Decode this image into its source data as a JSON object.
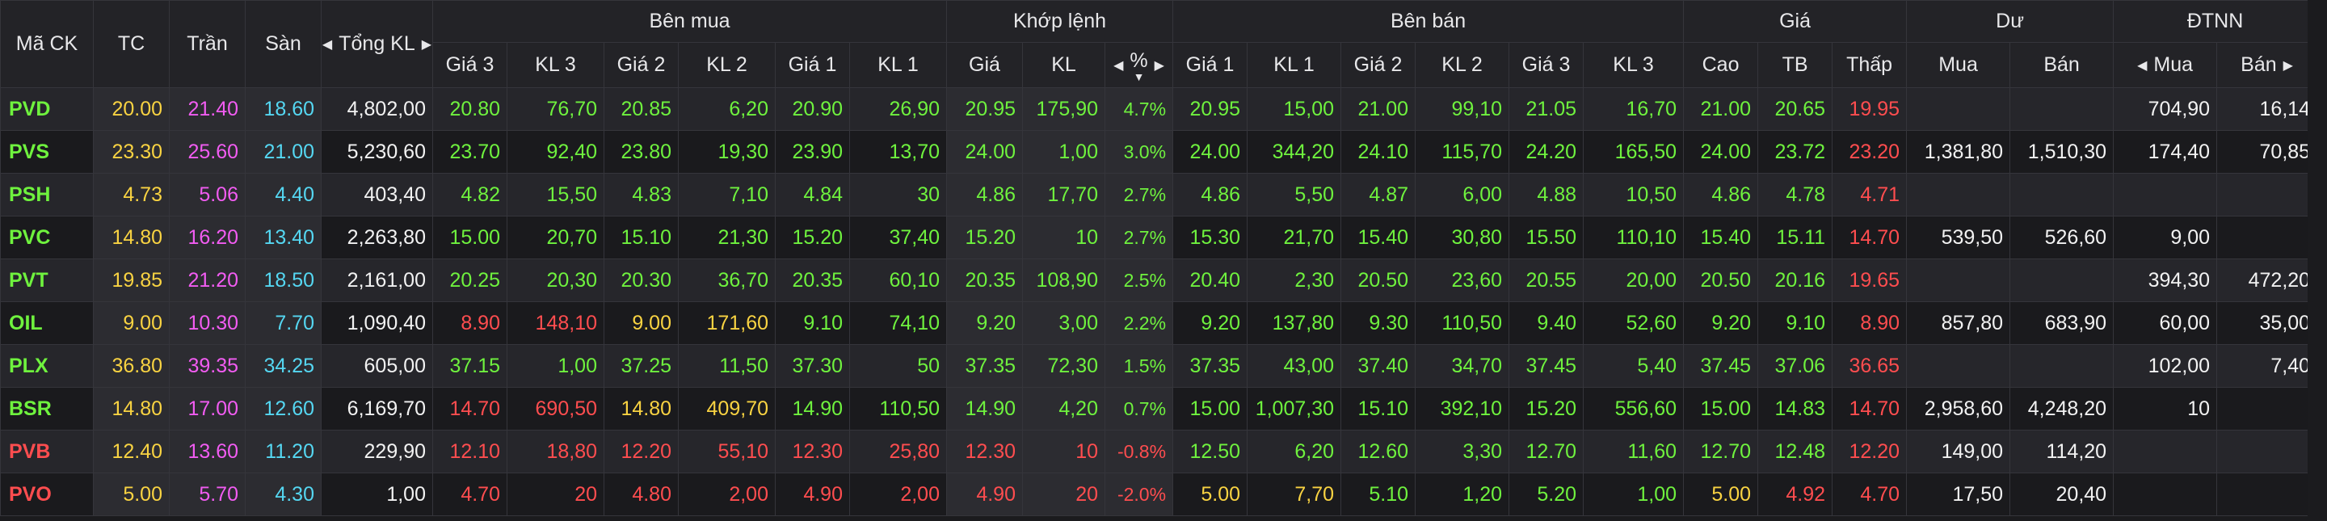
{
  "header": {
    "top": {
      "symbol": "Mã CK",
      "ref": "TC",
      "ceil": "Trần",
      "floor": "Sàn",
      "total_vol": "Tổng KL",
      "buy": "Bên mua",
      "match": "Khớp lệnh",
      "sell": "Bên bán",
      "price": "Giá",
      "surplus": "Dư",
      "foreign": "ĐTNN"
    },
    "sub": {
      "buy": [
        "Giá 3",
        "KL 3",
        "Giá 2",
        "KL 2",
        "Giá 1",
        "KL 1"
      ],
      "match": [
        "Giá",
        "KL",
        "%"
      ],
      "sell": [
        "Giá 1",
        "KL 1",
        "Giá 2",
        "KL 2",
        "Giá 3",
        "KL 3"
      ],
      "price": [
        "Cao",
        "TB",
        "Thấp"
      ],
      "surplus": [
        "Mua",
        "Bán"
      ],
      "foreign": [
        "Mua",
        "Bán"
      ]
    }
  },
  "rows": [
    {
      "symbol": "PVD",
      "c": "up",
      "ref": "20.00",
      "ceil": "21.40",
      "floor": "18.60",
      "total": "4,802,00",
      "buy": [
        [
          "20.80",
          "up"
        ],
        [
          "76,70",
          "up"
        ],
        [
          "20.85",
          "up"
        ],
        [
          "6,20",
          "up"
        ],
        [
          "20.90",
          "up"
        ],
        [
          "26,90",
          "up"
        ]
      ],
      "match": [
        [
          "20.95",
          "up"
        ],
        [
          "175,90",
          "up"
        ],
        [
          "4.7%",
          "up"
        ]
      ],
      "sell": [
        [
          "20.95",
          "up"
        ],
        [
          "15,00",
          "up"
        ],
        [
          "21.00",
          "up"
        ],
        [
          "99,10",
          "up"
        ],
        [
          "21.05",
          "up"
        ],
        [
          "16,70",
          "up"
        ]
      ],
      "high": [
        "21.00",
        "up"
      ],
      "avg": [
        "20.65",
        "up"
      ],
      "low": [
        "19.95",
        "down"
      ],
      "sur_buy": "",
      "sur_sell": "",
      "f_buy": "704,90",
      "f_sell": "16,14"
    },
    {
      "symbol": "PVS",
      "c": "up",
      "ref": "23.30",
      "ceil": "25.60",
      "floor": "21.00",
      "total": "5,230,60",
      "buy": [
        [
          "23.70",
          "up"
        ],
        [
          "92,40",
          "up"
        ],
        [
          "23.80",
          "up"
        ],
        [
          "19,30",
          "up"
        ],
        [
          "23.90",
          "up"
        ],
        [
          "13,70",
          "up"
        ]
      ],
      "match": [
        [
          "24.00",
          "up"
        ],
        [
          "1,00",
          "up"
        ],
        [
          "3.0%",
          "up"
        ]
      ],
      "sell": [
        [
          "24.00",
          "up"
        ],
        [
          "344,20",
          "up"
        ],
        [
          "24.10",
          "up"
        ],
        [
          "115,70",
          "up"
        ],
        [
          "24.20",
          "up"
        ],
        [
          "165,50",
          "up"
        ]
      ],
      "high": [
        "24.00",
        "up"
      ],
      "avg": [
        "23.72",
        "up"
      ],
      "low": [
        "23.20",
        "down"
      ],
      "sur_buy": "1,381,80",
      "sur_sell": "1,510,30",
      "f_buy": "174,40",
      "f_sell": "70,85"
    },
    {
      "symbol": "PSH",
      "c": "up",
      "ref": "4.73",
      "ceil": "5.06",
      "floor": "4.40",
      "total": "403,40",
      "buy": [
        [
          "4.82",
          "up"
        ],
        [
          "15,50",
          "up"
        ],
        [
          "4.83",
          "up"
        ],
        [
          "7,10",
          "up"
        ],
        [
          "4.84",
          "up"
        ],
        [
          "30",
          "up"
        ]
      ],
      "match": [
        [
          "4.86",
          "up"
        ],
        [
          "17,70",
          "up"
        ],
        [
          "2.7%",
          "up"
        ]
      ],
      "sell": [
        [
          "4.86",
          "up"
        ],
        [
          "5,50",
          "up"
        ],
        [
          "4.87",
          "up"
        ],
        [
          "6,00",
          "up"
        ],
        [
          "4.88",
          "up"
        ],
        [
          "10,50",
          "up"
        ]
      ],
      "high": [
        "4.86",
        "up"
      ],
      "avg": [
        "4.78",
        "up"
      ],
      "low": [
        "4.71",
        "down"
      ],
      "sur_buy": "",
      "sur_sell": "",
      "f_buy": "",
      "f_sell": ""
    },
    {
      "symbol": "PVC",
      "c": "up",
      "ref": "14.80",
      "ceil": "16.20",
      "floor": "13.40",
      "total": "2,263,80",
      "buy": [
        [
          "15.00",
          "up"
        ],
        [
          "20,70",
          "up"
        ],
        [
          "15.10",
          "up"
        ],
        [
          "21,30",
          "up"
        ],
        [
          "15.20",
          "up"
        ],
        [
          "37,40",
          "up"
        ]
      ],
      "match": [
        [
          "15.20",
          "up"
        ],
        [
          "10",
          "up"
        ],
        [
          "2.7%",
          "up"
        ]
      ],
      "sell": [
        [
          "15.30",
          "up"
        ],
        [
          "21,70",
          "up"
        ],
        [
          "15.40",
          "up"
        ],
        [
          "30,80",
          "up"
        ],
        [
          "15.50",
          "up"
        ],
        [
          "110,10",
          "up"
        ]
      ],
      "high": [
        "15.40",
        "up"
      ],
      "avg": [
        "15.11",
        "up"
      ],
      "low": [
        "14.70",
        "down"
      ],
      "sur_buy": "539,50",
      "sur_sell": "526,60",
      "f_buy": "9,00",
      "f_sell": ""
    },
    {
      "symbol": "PVT",
      "c": "up",
      "ref": "19.85",
      "ceil": "21.20",
      "floor": "18.50",
      "total": "2,161,00",
      "buy": [
        [
          "20.25",
          "up"
        ],
        [
          "20,30",
          "up"
        ],
        [
          "20.30",
          "up"
        ],
        [
          "36,70",
          "up"
        ],
        [
          "20.35",
          "up"
        ],
        [
          "60,10",
          "up"
        ]
      ],
      "match": [
        [
          "20.35",
          "up"
        ],
        [
          "108,90",
          "up"
        ],
        [
          "2.5%",
          "up"
        ]
      ],
      "sell": [
        [
          "20.40",
          "up"
        ],
        [
          "2,30",
          "up"
        ],
        [
          "20.50",
          "up"
        ],
        [
          "23,60",
          "up"
        ],
        [
          "20.55",
          "up"
        ],
        [
          "20,00",
          "up"
        ]
      ],
      "high": [
        "20.50",
        "up"
      ],
      "avg": [
        "20.16",
        "up"
      ],
      "low": [
        "19.65",
        "down"
      ],
      "sur_buy": "",
      "sur_sell": "",
      "f_buy": "394,30",
      "f_sell": "472,20"
    },
    {
      "symbol": "OIL",
      "c": "up",
      "ref": "9.00",
      "ceil": "10.30",
      "floor": "7.70",
      "total": "1,090,40",
      "buy": [
        [
          "8.90",
          "down"
        ],
        [
          "148,10",
          "down"
        ],
        [
          "9.00",
          "ref"
        ],
        [
          "171,60",
          "ref"
        ],
        [
          "9.10",
          "up"
        ],
        [
          "74,10",
          "up"
        ]
      ],
      "match": [
        [
          "9.20",
          "up"
        ],
        [
          "3,00",
          "up"
        ],
        [
          "2.2%",
          "up"
        ]
      ],
      "sell": [
        [
          "9.20",
          "up"
        ],
        [
          "137,80",
          "up"
        ],
        [
          "9.30",
          "up"
        ],
        [
          "110,50",
          "up"
        ],
        [
          "9.40",
          "up"
        ],
        [
          "52,60",
          "up"
        ]
      ],
      "high": [
        "9.20",
        "up"
      ],
      "avg": [
        "9.10",
        "up"
      ],
      "low": [
        "8.90",
        "down"
      ],
      "sur_buy": "857,80",
      "sur_sell": "683,90",
      "f_buy": "60,00",
      "f_sell": "35,00"
    },
    {
      "symbol": "PLX",
      "c": "up",
      "ref": "36.80",
      "ceil": "39.35",
      "floor": "34.25",
      "total": "605,00",
      "buy": [
        [
          "37.15",
          "up"
        ],
        [
          "1,00",
          "up"
        ],
        [
          "37.25",
          "up"
        ],
        [
          "11,50",
          "up"
        ],
        [
          "37.30",
          "up"
        ],
        [
          "50",
          "up"
        ]
      ],
      "match": [
        [
          "37.35",
          "up"
        ],
        [
          "72,30",
          "up"
        ],
        [
          "1.5%",
          "up"
        ]
      ],
      "sell": [
        [
          "37.35",
          "up"
        ],
        [
          "43,00",
          "up"
        ],
        [
          "37.40",
          "up"
        ],
        [
          "34,70",
          "up"
        ],
        [
          "37.45",
          "up"
        ],
        [
          "5,40",
          "up"
        ]
      ],
      "high": [
        "37.45",
        "up"
      ],
      "avg": [
        "37.06",
        "up"
      ],
      "low": [
        "36.65",
        "down"
      ],
      "sur_buy": "",
      "sur_sell": "",
      "f_buy": "102,00",
      "f_sell": "7,40"
    },
    {
      "symbol": "BSR",
      "c": "up",
      "ref": "14.80",
      "ceil": "17.00",
      "floor": "12.60",
      "total": "6,169,70",
      "buy": [
        [
          "14.70",
          "down"
        ],
        [
          "690,50",
          "down"
        ],
        [
          "14.80",
          "ref"
        ],
        [
          "409,70",
          "ref"
        ],
        [
          "14.90",
          "up"
        ],
        [
          "110,50",
          "up"
        ]
      ],
      "match": [
        [
          "14.90",
          "up"
        ],
        [
          "4,20",
          "up"
        ],
        [
          "0.7%",
          "up"
        ]
      ],
      "sell": [
        [
          "15.00",
          "up"
        ],
        [
          "1,007,30",
          "up"
        ],
        [
          "15.10",
          "up"
        ],
        [
          "392,10",
          "up"
        ],
        [
          "15.20",
          "up"
        ],
        [
          "556,60",
          "up"
        ]
      ],
      "high": [
        "15.00",
        "up"
      ],
      "avg": [
        "14.83",
        "up"
      ],
      "low": [
        "14.70",
        "down"
      ],
      "sur_buy": "2,958,60",
      "sur_sell": "4,248,20",
      "f_buy": "10",
      "f_sell": ""
    },
    {
      "symbol": "PVB",
      "c": "down",
      "ref": "12.40",
      "ceil": "13.60",
      "floor": "11.20",
      "total": "229,90",
      "buy": [
        [
          "12.10",
          "down"
        ],
        [
          "18,80",
          "down"
        ],
        [
          "12.20",
          "down"
        ],
        [
          "55,10",
          "down"
        ],
        [
          "12.30",
          "down"
        ],
        [
          "25,80",
          "down"
        ]
      ],
      "match": [
        [
          "12.30",
          "down"
        ],
        [
          "10",
          "down"
        ],
        [
          "-0.8%",
          "down"
        ]
      ],
      "sell": [
        [
          "12.50",
          "up"
        ],
        [
          "6,20",
          "up"
        ],
        [
          "12.60",
          "up"
        ],
        [
          "3,30",
          "up"
        ],
        [
          "12.70",
          "up"
        ],
        [
          "11,60",
          "up"
        ]
      ],
      "high": [
        "12.70",
        "up"
      ],
      "avg": [
        "12.48",
        "up"
      ],
      "low": [
        "12.20",
        "down"
      ],
      "sur_buy": "149,00",
      "sur_sell": "114,20",
      "f_buy": "",
      "f_sell": ""
    },
    {
      "symbol": "PVO",
      "c": "down",
      "ref": "5.00",
      "ceil": "5.70",
      "floor": "4.30",
      "total": "1,00",
      "buy": [
        [
          "4.70",
          "down"
        ],
        [
          "20",
          "down"
        ],
        [
          "4.80",
          "down"
        ],
        [
          "2,00",
          "down"
        ],
        [
          "4.90",
          "down"
        ],
        [
          "2,00",
          "down"
        ]
      ],
      "match": [
        [
          "4.90",
          "down"
        ],
        [
          "20",
          "down"
        ],
        [
          "-2.0%",
          "down"
        ]
      ],
      "sell": [
        [
          "5.00",
          "ref"
        ],
        [
          "7,70",
          "ref"
        ],
        [
          "5.10",
          "up"
        ],
        [
          "1,20",
          "up"
        ],
        [
          "5.20",
          "up"
        ],
        [
          "1,00",
          "up"
        ]
      ],
      "high": [
        "5.00",
        "ref"
      ],
      "avg": [
        "4.92",
        "down"
      ],
      "low": [
        "4.70",
        "down"
      ],
      "sur_buy": "17,50",
      "sur_sell": "20,40",
      "f_buy": "",
      "f_sell": ""
    }
  ]
}
